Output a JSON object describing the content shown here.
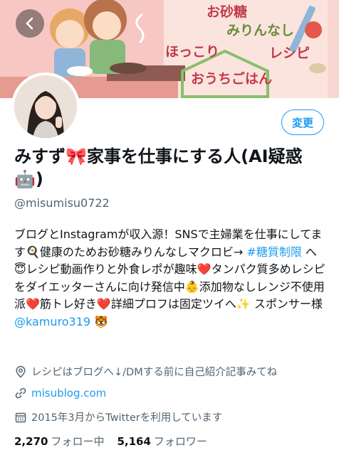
{
  "banner": {
    "phrases": [
      "お砂糖",
      "みりんなし",
      "ほっこり",
      "レシピ",
      "おうちごはん"
    ],
    "bg_color": "#f6c7c3"
  },
  "header": {
    "back_icon": "chevron-left-icon",
    "edit_label": "変更"
  },
  "profile": {
    "name_text": "みすず🎀家事を仕事にする人(AI疑惑🤖)",
    "handle": "@misumisu0722",
    "bio": {
      "part1": "ブログとInstagramが収入源！SNSで主婦業を仕事にしてます🍳健康のためお砂糖みりんなしマクロビ→ ",
      "hashtag": "#糖質制限",
      "part2": " へ😇レシピ動画作りと外食レポが趣味❤️タンパク質多めレシピをダイエッターさんに向け発信中👶添加物なしレンジ不使用派❤️筋トレ好き❤️詳細プロフは固定ツイへ✨ スポンサー様 ",
      "mention": "@kamuro319",
      "part3": " 🐯"
    },
    "location": "レシピはブログへ↓/DMする前に自己紹介記事みてね",
    "website": "misublog.com",
    "joined": "2015年3月からTwitterを利用しています",
    "following_count": "2,270",
    "following_label": "フォロー中",
    "followers_count": "5,164",
    "followers_label": "フォロワー"
  },
  "colors": {
    "accent": "#1d9bf0",
    "secondary_text": "#536471"
  }
}
